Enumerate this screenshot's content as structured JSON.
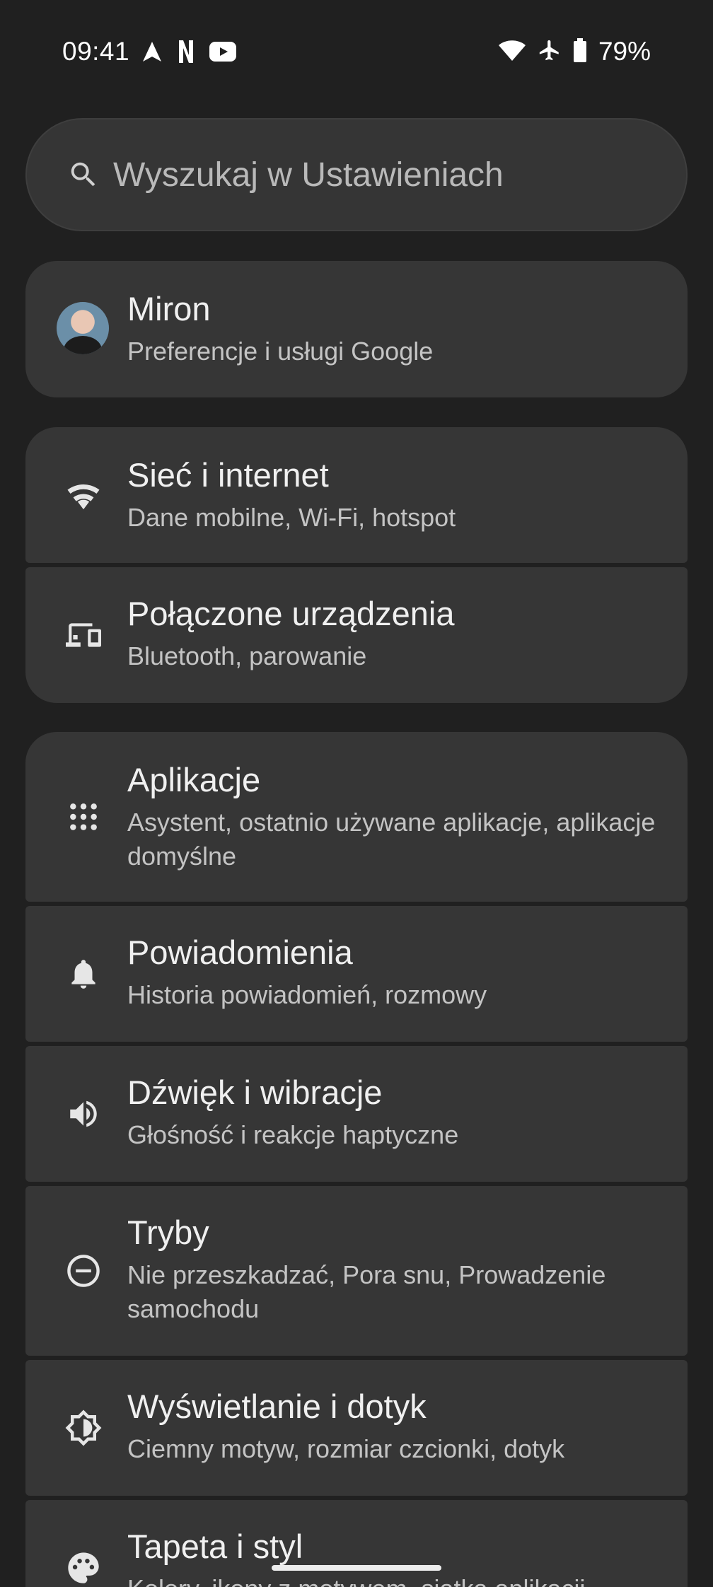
{
  "status_bar": {
    "time": "09:41",
    "left_icons": [
      "navigation-arrow-icon",
      "netflix-icon",
      "youtube-icon"
    ],
    "right_icons": [
      "wifi-icon",
      "airplane-icon",
      "battery-icon"
    ],
    "battery_percent": "79%"
  },
  "search": {
    "placeholder": "Wyszukaj w Ustawieniach"
  },
  "account": {
    "name": "Miron",
    "subtitle": "Preferencje i usługi Google"
  },
  "settings": [
    {
      "title": "Sieć i internet",
      "subtitle": "Dane mobilne, Wi-Fi, hotspot",
      "icon": "wifi-icon"
    },
    {
      "title": "Połączone urządzenia",
      "subtitle": "Bluetooth, parowanie",
      "icon": "connected-devices-icon"
    },
    {
      "title": "Aplikacje",
      "subtitle": "Asystent, ostatnio używane aplikacje, aplikacje domyślne",
      "icon": "apps-grid-icon"
    },
    {
      "title": "Powiadomienia",
      "subtitle": "Historia powiadomień, rozmowy",
      "icon": "bell-icon"
    },
    {
      "title": "Dźwięk i wibracje",
      "subtitle": "Głośność i reakcje haptyczne",
      "icon": "volume-icon"
    },
    {
      "title": "Tryby",
      "subtitle": "Nie przeszkadzać, Pora snu, Prowadzenie samochodu",
      "icon": "do-not-disturb-icon"
    },
    {
      "title": "Wyświetlanie i dotyk",
      "subtitle": "Ciemny motyw, rozmiar czcionki, dotyk",
      "icon": "brightness-icon"
    },
    {
      "title": "Tapeta i styl",
      "subtitle": "Kolory, ikony z motywem, siatka aplikacji",
      "icon": "palette-icon"
    }
  ],
  "colors": {
    "background": "#202020",
    "card": "#363636",
    "text_primary": "#f0f0f0",
    "text_secondary": "#c4c4c4"
  }
}
